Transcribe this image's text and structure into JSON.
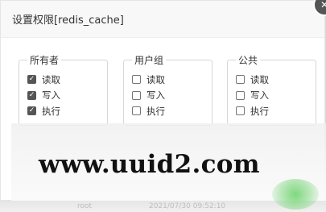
{
  "dialog": {
    "title": "设置权限[redis_cache]",
    "close_label": "✕",
    "groups": [
      {
        "legend": "所有者",
        "options": [
          {
            "label": "读取",
            "checked": true
          },
          {
            "label": "写入",
            "checked": true
          },
          {
            "label": "执行",
            "checked": true
          }
        ]
      },
      {
        "legend": "用户组",
        "options": [
          {
            "label": "读取",
            "checked": false
          },
          {
            "label": "写入",
            "checked": false
          },
          {
            "label": "执行",
            "checked": false
          }
        ]
      },
      {
        "legend": "公共",
        "options": [
          {
            "label": "读取",
            "checked": false
          },
          {
            "label": "写入",
            "checked": false
          },
          {
            "label": "执行",
            "checked": false
          }
        ]
      }
    ]
  },
  "watermark": {
    "text": "www.uuid2.com"
  },
  "background": {
    "row_fragment_1": "root",
    "row_fragment_2": "2021/07/30 09:52:10"
  },
  "colors": {
    "checkbox_checked": "#555555",
    "watermark_blob": "#7ed67e"
  }
}
